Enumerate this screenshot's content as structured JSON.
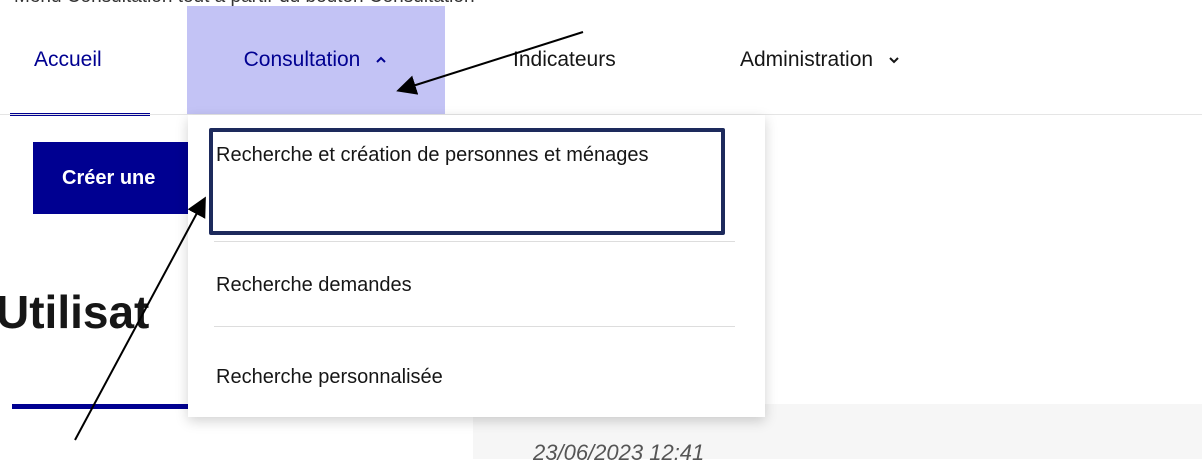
{
  "instruction": {
    "text": "Menu Consultation tout à partir du bouton Consultation"
  },
  "nav": {
    "items": [
      {
        "label": "Accueil"
      },
      {
        "label": "Consultation"
      },
      {
        "label": "Indicateurs"
      },
      {
        "label": "Administration"
      }
    ],
    "active_item": "Accueil",
    "open_menu": "Consultation"
  },
  "consultation_menu": {
    "items": [
      {
        "label": "Recherche et création de personnes et ménages",
        "highlighted": true
      },
      {
        "label": "Recherche demandes"
      },
      {
        "label": "Recherche personnalisée"
      }
    ]
  },
  "page": {
    "create_button_label": "Créer une",
    "heading": "Utilisat",
    "timestamp": "23/06/2023 12:41"
  },
  "colors": {
    "primary": "#000091",
    "menu_highlight_bg": "#c3c3f5",
    "annotation_box": "#1d2a5c"
  },
  "icons": {
    "consultation_chevron": "chevron-up-icon",
    "administration_chevron": "chevron-down-icon"
  }
}
